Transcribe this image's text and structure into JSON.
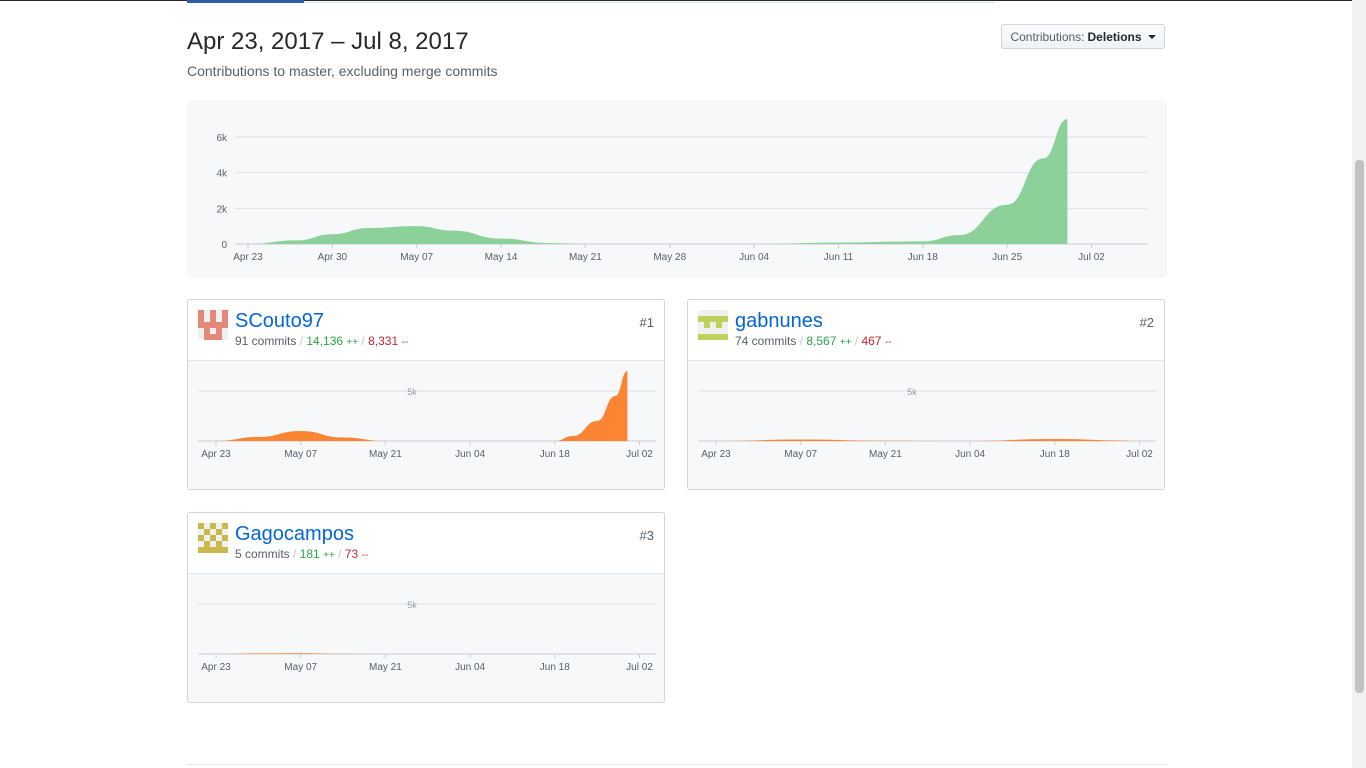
{
  "header": {
    "date_range": "Apr 23, 2017 – Jul 8, 2017",
    "subtitle": "Contributions to master, excluding merge commits"
  },
  "contributions_select": {
    "prefix": "Contributions:",
    "value": "Deletions"
  },
  "colors": {
    "main_area": "#8cd19a",
    "user_area": "#fb8532",
    "link": "#0366d6",
    "additions": "#28a745",
    "deletions": "#cb2431"
  },
  "chart_data": [
    {
      "type": "area",
      "x": [
        "Apr 23",
        "Apr 30",
        "May 07",
        "May 14",
        "May 21",
        "May 28",
        "Jun 04",
        "Jun 11",
        "Jun 18",
        "Jun 25",
        "Jul 02"
      ],
      "ytick_labels": [
        "0",
        "2k",
        "4k",
        "6k"
      ],
      "ylim": [
        0,
        6000
      ],
      "series": [
        {
          "x": [
            "Apr 23",
            "Apr 27",
            "Apr 30",
            "May 03",
            "May 07",
            "May 10",
            "May 14",
            "May 18",
            "May 21",
            "Jun 04",
            "Jun 11",
            "Jun 18",
            "Jun 21",
            "Jun 25",
            "Jun 28",
            "Jun 30"
          ],
          "y": [
            0,
            200,
            550,
            900,
            1000,
            750,
            300,
            50,
            0,
            0,
            80,
            150,
            500,
            2200,
            4800,
            7000
          ]
        }
      ],
      "grid": true
    },
    {
      "type": "area",
      "user": "SCouto97",
      "x": [
        "Apr 23",
        "May 07",
        "May 21",
        "Jun 04",
        "Jun 18",
        "Jul 02"
      ],
      "ytick_labels": [
        "5k"
      ],
      "series": [
        {
          "x": [
            "Apr 23",
            "Apr 30",
            "May 07",
            "May 14",
            "May 21",
            "Jun 04",
            "Jun 18",
            "Jun 21",
            "Jun 25",
            "Jun 28",
            "Jun 30"
          ],
          "y": [
            0,
            400,
            1000,
            350,
            0,
            0,
            0,
            500,
            2000,
            4500,
            7000
          ]
        }
      ],
      "grid": true
    },
    {
      "type": "area",
      "user": "gabnunes",
      "x": [
        "Apr 23",
        "May 07",
        "May 21",
        "Jun 04",
        "Jun 18",
        "Jul 02"
      ],
      "ytick_labels": [
        "5k"
      ],
      "series": [
        {
          "x": [
            "Apr 23",
            "May 07",
            "May 21",
            "Jun 04",
            "Jun 18",
            "Jun 30"
          ],
          "y": [
            0,
            150,
            30,
            0,
            200,
            50
          ]
        }
      ],
      "grid": true
    },
    {
      "type": "area",
      "user": "Gagocampos",
      "x": [
        "Apr 23",
        "May 07",
        "May 21",
        "Jun 04",
        "Jun 18",
        "Jul 02"
      ],
      "ytick_labels": [
        "5k"
      ],
      "series": [
        {
          "x": [
            "Apr 23",
            "Apr 30",
            "May 07",
            "May 14",
            "May 21"
          ],
          "y": [
            0,
            60,
            80,
            30,
            0
          ]
        }
      ],
      "grid": true
    }
  ],
  "contributors": [
    {
      "username": "SCouto97",
      "commits": "91 commits",
      "additions": "14,136",
      "deletions": "8,331",
      "add_suffix": "++",
      "del_suffix": "--",
      "rank": "#1"
    },
    {
      "username": "gabnunes",
      "commits": "74 commits",
      "additions": "8,567",
      "deletions": "467",
      "add_suffix": "++",
      "del_suffix": "--",
      "rank": "#2"
    },
    {
      "username": "Gagocampos",
      "commits": "5 commits",
      "additions": "181",
      "deletions": "73",
      "add_suffix": "++",
      "del_suffix": "--",
      "rank": "#3"
    }
  ]
}
